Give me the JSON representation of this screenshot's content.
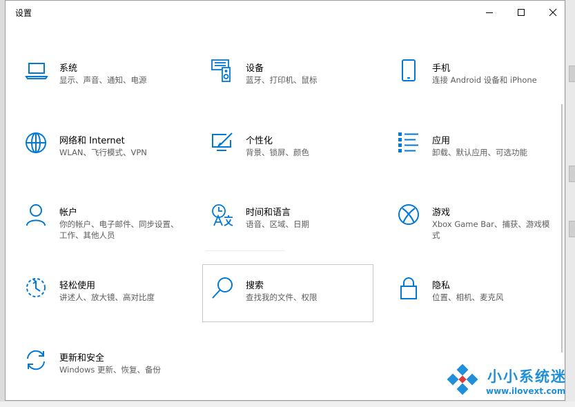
{
  "window": {
    "title": "设置"
  },
  "controls": {
    "minimize_icon": "minimize-icon",
    "maximize_icon": "maximize-icon",
    "close_icon": "close-icon"
  },
  "accent_color": "#0078d7",
  "tiles": [
    {
      "name": "系统",
      "desc": "显示、声音、通知、电源",
      "icon": "laptop-icon"
    },
    {
      "name": "设备",
      "desc": "蓝牙、打印机、鼠标",
      "icon": "devices-icon"
    },
    {
      "name": "手机",
      "desc": "连接 Android 设备和 iPhone",
      "icon": "phone-icon"
    },
    {
      "name": "网络和 Internet",
      "desc": "WLAN、飞行模式、VPN",
      "icon": "globe-icon"
    },
    {
      "name": "个性化",
      "desc": "背景、锁屏、颜色",
      "icon": "personalization-icon"
    },
    {
      "name": "应用",
      "desc": "卸载、默认应用、可选功能",
      "icon": "apps-list-icon"
    },
    {
      "name": "帐户",
      "desc": "你的帐户、电子邮件、同步设置、工作、其他人员",
      "icon": "person-icon"
    },
    {
      "name": "时间和语言",
      "desc": "语音、区域、日期",
      "icon": "time-language-icon"
    },
    {
      "name": "游戏",
      "desc": "Xbox Game Bar、捕获、游戏模式",
      "icon": "xbox-icon"
    },
    {
      "name": "轻松使用",
      "desc": "讲述人、放大镜、高对比度",
      "icon": "ease-of-access-icon"
    },
    {
      "name": "搜索",
      "desc": "查找我的文件、权限",
      "icon": "search-icon"
    },
    {
      "name": "隐私",
      "desc": "位置、相机、麦克风",
      "icon": "lock-icon"
    },
    {
      "name": "更新和安全",
      "desc": "Windows 更新、恢复、备份",
      "icon": "update-sync-icon"
    }
  ],
  "watermark": {
    "text": "小小系统迷",
    "url": "www.ilovext.com"
  }
}
